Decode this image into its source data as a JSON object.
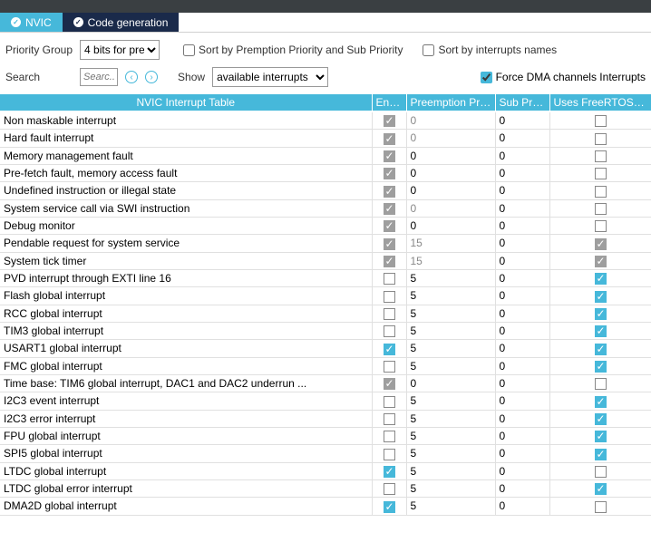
{
  "titlebar": "",
  "tabs": {
    "nvic": "NVIC",
    "codegen": "Code generation"
  },
  "toolbar": {
    "priorityGroupLabel": "Priority Group",
    "priorityGroupValue": "4 bits for pre-...",
    "sortPreemption": "Sort by Premption Priority and Sub Priority",
    "sortNames": "Sort by interrupts names",
    "searchLabel": "Search",
    "searchPlaceholder": "Searc...",
    "showLabel": "Show",
    "showValue": "available interrupts",
    "forceDma": "Force DMA channels Interrupts"
  },
  "headers": {
    "name": "NVIC Interrupt Table",
    "enabled": "Enabl...",
    "preempt": "Preemption Pri...",
    "sub": "Sub Prio...",
    "freertos": "Uses FreeRTOS fun..."
  },
  "rows": [
    {
      "name": "Non maskable interrupt",
      "enabled": true,
      "enabledGray": true,
      "preempt": "0",
      "preemptGray": true,
      "sub": "0",
      "freertos": false,
      "freertosGray": false
    },
    {
      "name": "Hard fault interrupt",
      "enabled": true,
      "enabledGray": true,
      "preempt": "0",
      "preemptGray": true,
      "sub": "0",
      "freertos": false,
      "freertosGray": false
    },
    {
      "name": "Memory management fault",
      "enabled": true,
      "enabledGray": true,
      "preempt": "0",
      "preemptGray": false,
      "sub": "0",
      "freertos": false,
      "freertosGray": false
    },
    {
      "name": "Pre-fetch fault, memory access fault",
      "enabled": true,
      "enabledGray": true,
      "preempt": "0",
      "preemptGray": false,
      "sub": "0",
      "freertos": false,
      "freertosGray": false
    },
    {
      "name": "Undefined instruction or illegal state",
      "enabled": true,
      "enabledGray": true,
      "preempt": "0",
      "preemptGray": false,
      "sub": "0",
      "freertos": false,
      "freertosGray": false
    },
    {
      "name": "System service call via SWI instruction",
      "enabled": true,
      "enabledGray": true,
      "preempt": "0",
      "preemptGray": true,
      "sub": "0",
      "freertos": false,
      "freertosGray": false
    },
    {
      "name": "Debug monitor",
      "enabled": true,
      "enabledGray": true,
      "preempt": "0",
      "preemptGray": false,
      "sub": "0",
      "freertos": false,
      "freertosGray": false
    },
    {
      "name": "Pendable request for system service",
      "enabled": true,
      "enabledGray": true,
      "preempt": "15",
      "preemptGray": true,
      "sub": "0",
      "freertos": true,
      "freertosGray": true
    },
    {
      "name": "System tick timer",
      "enabled": true,
      "enabledGray": true,
      "preempt": "15",
      "preemptGray": true,
      "sub": "0",
      "freertos": true,
      "freertosGray": true
    },
    {
      "name": "PVD interrupt through EXTI line 16",
      "enabled": false,
      "enabledGray": false,
      "preempt": "5",
      "preemptGray": false,
      "sub": "0",
      "freertos": true,
      "freertosGray": false
    },
    {
      "name": "Flash global interrupt",
      "enabled": false,
      "enabledGray": false,
      "preempt": "5",
      "preemptGray": false,
      "sub": "0",
      "freertos": true,
      "freertosGray": false
    },
    {
      "name": "RCC global interrupt",
      "enabled": false,
      "enabledGray": false,
      "preempt": "5",
      "preemptGray": false,
      "sub": "0",
      "freertos": true,
      "freertosGray": false
    },
    {
      "name": "TIM3 global interrupt",
      "enabled": false,
      "enabledGray": false,
      "preempt": "5",
      "preemptGray": false,
      "sub": "0",
      "freertos": true,
      "freertosGray": false
    },
    {
      "name": "USART1 global interrupt",
      "enabled": true,
      "enabledGray": false,
      "preempt": "5",
      "preemptGray": false,
      "sub": "0",
      "freertos": true,
      "freertosGray": false
    },
    {
      "name": "FMC global interrupt",
      "enabled": false,
      "enabledGray": false,
      "preempt": "5",
      "preemptGray": false,
      "sub": "0",
      "freertos": true,
      "freertosGray": false
    },
    {
      "name": "Time base: TIM6 global interrupt, DAC1 and DAC2 underrun ...",
      "enabled": true,
      "enabledGray": true,
      "preempt": "0",
      "preemptGray": false,
      "sub": "0",
      "freertos": false,
      "freertosGray": false
    },
    {
      "name": "I2C3 event interrupt",
      "enabled": false,
      "enabledGray": false,
      "preempt": "5",
      "preemptGray": false,
      "sub": "0",
      "freertos": true,
      "freertosGray": false
    },
    {
      "name": "I2C3 error interrupt",
      "enabled": false,
      "enabledGray": false,
      "preempt": "5",
      "preemptGray": false,
      "sub": "0",
      "freertos": true,
      "freertosGray": false
    },
    {
      "name": "FPU global interrupt",
      "enabled": false,
      "enabledGray": false,
      "preempt": "5",
      "preemptGray": false,
      "sub": "0",
      "freertos": true,
      "freertosGray": false
    },
    {
      "name": "SPI5 global interrupt",
      "enabled": false,
      "enabledGray": false,
      "preempt": "5",
      "preemptGray": false,
      "sub": "0",
      "freertos": true,
      "freertosGray": false
    },
    {
      "name": "LTDC global interrupt",
      "enabled": true,
      "enabledGray": false,
      "preempt": "5",
      "preemptGray": false,
      "sub": "0",
      "freertos": false,
      "freertosGray": false
    },
    {
      "name": "LTDC global error interrupt",
      "enabled": false,
      "enabledGray": false,
      "preempt": "5",
      "preemptGray": false,
      "sub": "0",
      "freertos": true,
      "freertosGray": false
    },
    {
      "name": "DMA2D global interrupt",
      "enabled": true,
      "enabledGray": false,
      "preempt": "5",
      "preemptGray": false,
      "sub": "0",
      "freertos": false,
      "freertosGray": false
    }
  ]
}
